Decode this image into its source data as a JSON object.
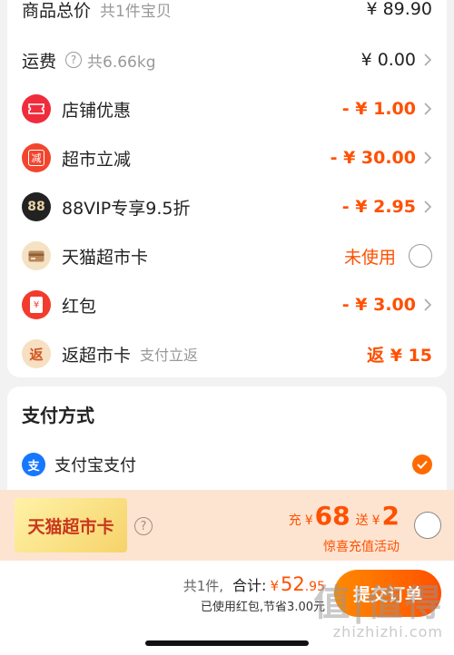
{
  "order_summary": {
    "goods_total_label": "商品总价",
    "goods_total_sub": "共1件宝贝",
    "goods_total_amount": "¥ 89.90",
    "shipping_label": "运费",
    "shipping_weight": "共6.66kg",
    "shipping_amount": "¥ 0.00",
    "store_discount_label": "店铺优惠",
    "store_discount_amount": "- ¥ 1.00",
    "supermarket_off_label": "超市立减",
    "supermarket_off_amount": "- ¥ 30.00",
    "vip_label": "88VIP专享9.5折",
    "vip_amount": "- ¥ 2.95",
    "vip_badge": "88",
    "card_label": "天猫超市卡",
    "card_status": "未使用",
    "redpacket_label": "红包",
    "redpacket_amount": "- ¥ 3.00",
    "redpacket_badge": "¥",
    "rebate_label": "返超市卡",
    "rebate_sub": "支付立返",
    "rebate_amount": "返 ¥ 15",
    "rebate_badge": "返",
    "supermarket_badge": "减"
  },
  "payment": {
    "title": "支付方式",
    "method_label": "支付宝支付",
    "method_icon": "支"
  },
  "promo": {
    "card_text": "天猫超市卡",
    "recharge_prefix": "充",
    "currency": "¥",
    "recharge_amount": "68",
    "gift_prefix": "送",
    "gift_amount": "2",
    "subtitle": "惊喜充值活动"
  },
  "footer": {
    "count": "共1件,",
    "total_label": "合计:",
    "currency": "¥",
    "total_int": "52",
    "total_dec": ".95",
    "note": "已使用红包,节省3.00元",
    "submit_label": "提交订单"
  },
  "watermark": {
    "big": "值|值得",
    "small": "zhizhizhi.com"
  },
  "colors": {
    "accent": "#ff5000",
    "card_bg": "#ffffff",
    "page_bg": "#f2f2f2"
  }
}
